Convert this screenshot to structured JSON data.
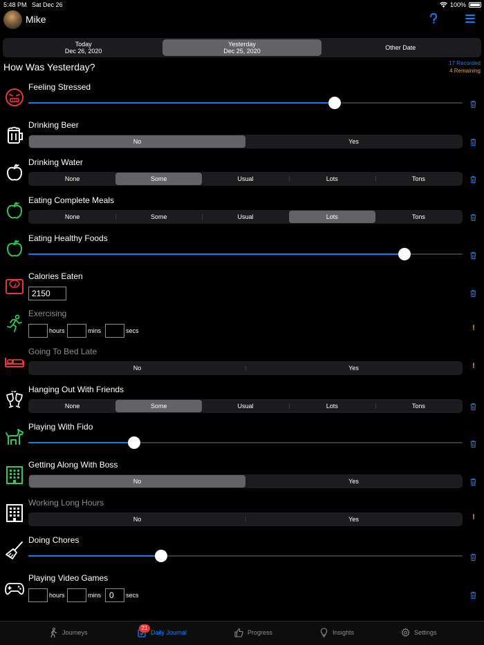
{
  "status": {
    "time": "5:48 PM",
    "date": "Sat Dec 26",
    "battery": "100%"
  },
  "header": {
    "user_name": "Mike"
  },
  "date_tabs": [
    {
      "line1": "Today",
      "line2": "Dec 26, 2020",
      "selected": false
    },
    {
      "line1": "Yesterday",
      "line2": "Dec 25, 2020",
      "selected": true
    },
    {
      "line1": "Other Date",
      "line2": "",
      "selected": false
    }
  ],
  "page_title": "How Was Yesterday?",
  "counts": {
    "recorded": "17 Recorded",
    "remaining": "4 Remaining"
  },
  "habits": [
    {
      "label": "Feeling Stressed",
      "icon": "stressed-face-icon",
      "type": "slider",
      "value": 0.705,
      "state": "recorded"
    },
    {
      "label": "Drinking Beer",
      "icon": "beer-mug-icon",
      "type": "segmented",
      "options": [
        "No",
        "Yes"
      ],
      "selected": "No",
      "state": "recorded"
    },
    {
      "label": "Drinking Water",
      "icon": "apple-icon",
      "type": "segmented",
      "options": [
        "None",
        "Some",
        "Usual",
        "Lots",
        "Tons"
      ],
      "selected": "Some",
      "state": "recorded"
    },
    {
      "label": "Eating Complete Meals",
      "icon": "apple-icon",
      "type": "segmented",
      "options": [
        "None",
        "Some",
        "Usual",
        "Lots",
        "Tons"
      ],
      "selected": "Lots",
      "state": "recorded"
    },
    {
      "label": "Eating Healthy Foods",
      "icon": "apple-icon",
      "type": "slider",
      "value": 0.866,
      "state": "recorded"
    },
    {
      "label": "Calories Eaten",
      "icon": "scale-icon",
      "type": "number",
      "value": "2150",
      "state": "recorded"
    },
    {
      "label": "Exercising",
      "icon": "running-person-icon",
      "type": "duration",
      "hours": "",
      "mins": "",
      "secs": "",
      "unit_hours": "hours",
      "unit_mins": "mins",
      "unit_secs": "secs",
      "state": "remaining"
    },
    {
      "label": "Going To Bed Late",
      "icon": "bed-icon",
      "type": "segmented",
      "options": [
        "No",
        "Yes"
      ],
      "selected": "",
      "state": "remaining"
    },
    {
      "label": "Hanging Out With Friends",
      "icon": "toast-glasses-icon",
      "type": "segmented",
      "options": [
        "None",
        "Some",
        "Usual",
        "Lots",
        "Tons"
      ],
      "selected": "Some",
      "state": "recorded"
    },
    {
      "label": "Playing With Fido",
      "icon": "dog-icon",
      "type": "slider",
      "value": 0.243,
      "state": "recorded"
    },
    {
      "label": "Getting Along With Boss",
      "icon": "office-building-icon",
      "type": "segmented",
      "options": [
        "No",
        "Yes"
      ],
      "selected": "No",
      "state": "recorded"
    },
    {
      "label": "Working Long Hours",
      "icon": "office-building-icon",
      "type": "segmented",
      "options": [
        "No",
        "Yes"
      ],
      "selected": "",
      "state": "remaining"
    },
    {
      "label": "Doing Chores",
      "icon": "broom-icon",
      "type": "slider",
      "value": 0.306,
      "state": "recorded"
    },
    {
      "label": "Playing Video Games",
      "icon": "gamepad-icon",
      "type": "duration",
      "hours": "",
      "mins": "",
      "secs": "0",
      "unit_hours": "hours",
      "unit_mins": "mins",
      "unit_secs": "secs",
      "state": "recorded"
    }
  ],
  "tab_bar": {
    "badge": "21",
    "items": [
      {
        "label": "Journeys",
        "icon": "walking-person-icon",
        "active": false
      },
      {
        "label": "Daily Journal",
        "icon": "journal-check-icon",
        "active": true
      },
      {
        "label": "Progress",
        "icon": "thumbs-up-icon",
        "active": false
      },
      {
        "label": "Insights",
        "icon": "lightbulb-icon",
        "active": false
      },
      {
        "label": "Settings",
        "icon": "gear-icon",
        "active": false
      }
    ]
  },
  "colors": {
    "accent": "#1a7cf5",
    "warning": "#f0a030",
    "red_icon": "#e53935",
    "green_icon": "#34c759"
  }
}
